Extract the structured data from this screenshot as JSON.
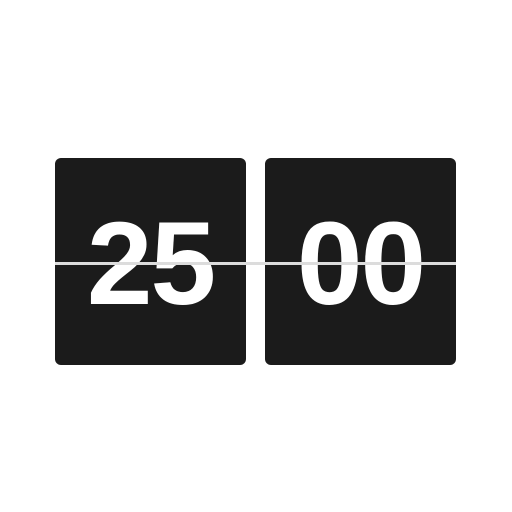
{
  "clock": {
    "minutes": "25",
    "seconds": "00"
  },
  "colors": {
    "background": "#ffffff",
    "card": "#1b1b1b",
    "digit": "#ffffff",
    "divider": "#dcdcdc"
  }
}
